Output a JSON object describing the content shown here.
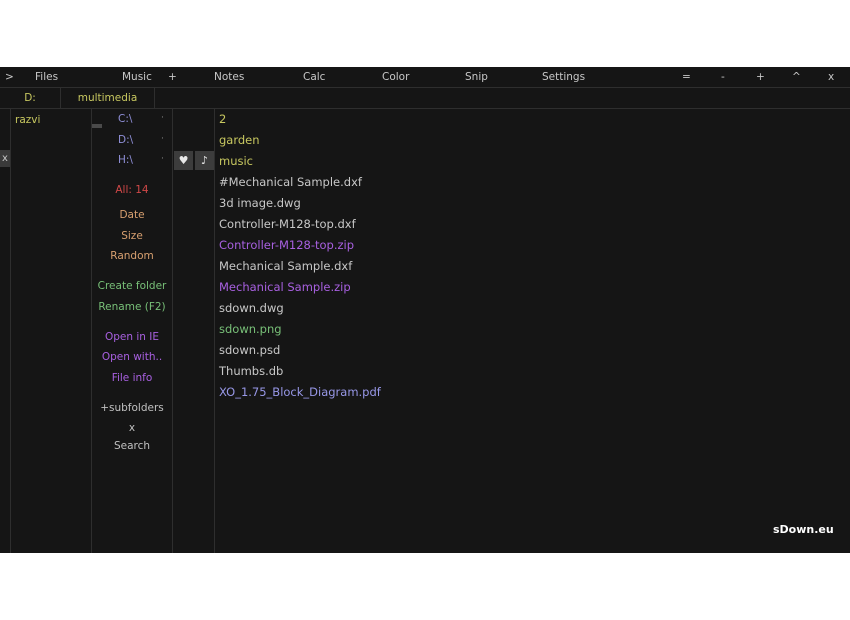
{
  "menubar": {
    "expand": ">",
    "items": [
      "Files",
      "Music",
      "+",
      "Notes",
      "Calc",
      "Color",
      "Snip",
      "Settings"
    ],
    "window_controls": [
      "=",
      "-",
      "+",
      "^",
      "x"
    ]
  },
  "pathbar": {
    "segments": [
      "D:",
      "multimedia"
    ]
  },
  "left": {
    "close": "x",
    "user": "razvi"
  },
  "drives": [
    {
      "label": "C:\\",
      "dot": "·"
    },
    {
      "label": "D:\\",
      "dot": "·"
    },
    {
      "label": "H:\\",
      "dot": "·"
    }
  ],
  "favorites": {
    "heart": "♥",
    "music": "♪"
  },
  "sidebar": {
    "count": "All: 14",
    "sort": [
      "Date",
      "Size",
      "Random"
    ],
    "actions": [
      "Create folder",
      "Rename (F2)"
    ],
    "open": [
      "Open in IE",
      "Open with..",
      "File info"
    ],
    "subfolders": "+subfolders",
    "clear": "x",
    "search": "Search"
  },
  "files": [
    {
      "name": "2",
      "type": "folder"
    },
    {
      "name": "garden",
      "type": "folder"
    },
    {
      "name": "music",
      "type": "folder"
    },
    {
      "name": "#Mechanical Sample.dxf",
      "type": "normal"
    },
    {
      "name": "3d image.dwg",
      "type": "normal"
    },
    {
      "name": "Controller-M128-top.dxf",
      "type": "normal"
    },
    {
      "name": "Controller-M128-top.zip",
      "type": "zip"
    },
    {
      "name": "Mechanical Sample.dxf",
      "type": "normal"
    },
    {
      "name": "Mechanical Sample.zip",
      "type": "zip"
    },
    {
      "name": "sdown.dwg",
      "type": "normal"
    },
    {
      "name": "sdown.png",
      "type": "png"
    },
    {
      "name": "sdown.psd",
      "type": "normal"
    },
    {
      "name": "Thumbs.db",
      "type": "normal"
    },
    {
      "name": "XO_1.75_Block_Diagram.pdf",
      "type": "pdf"
    }
  ],
  "brand": "sDown.eu"
}
